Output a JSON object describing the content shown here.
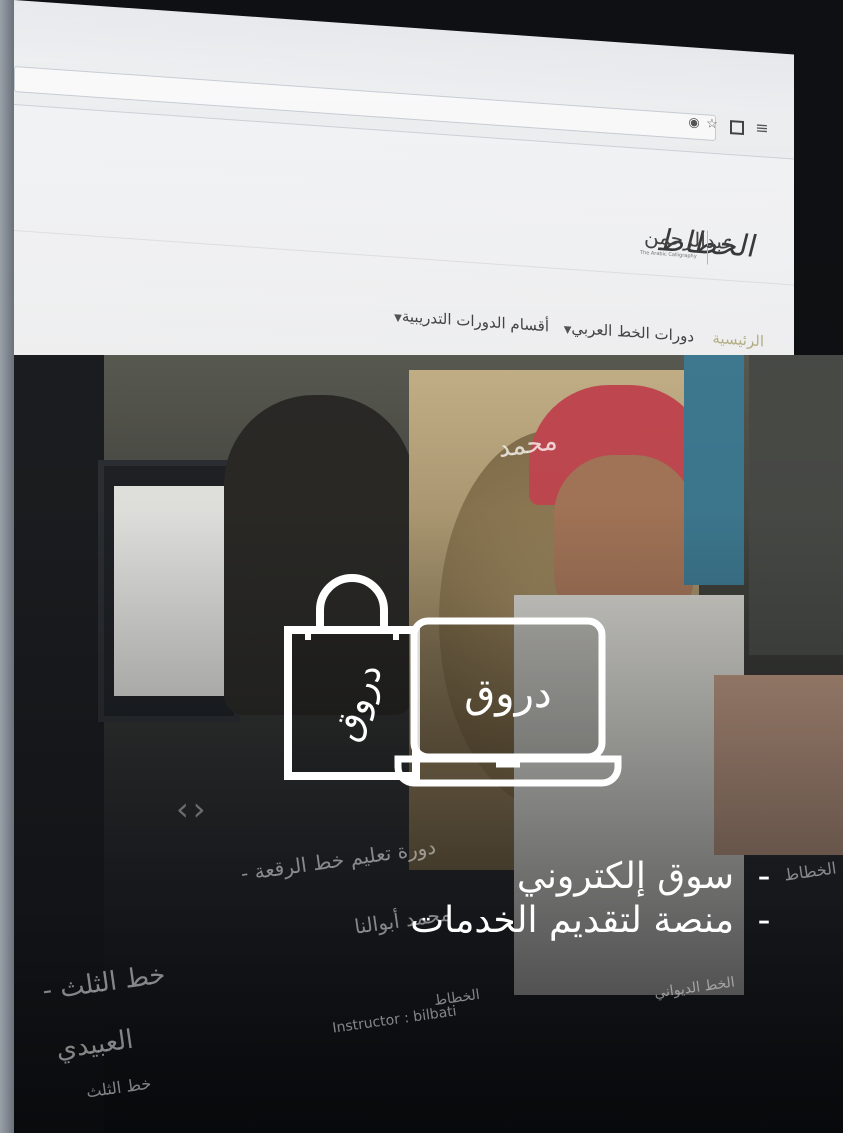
{
  "browser": {
    "menu_icon": "hamburger-icon"
  },
  "site": {
    "logo_text": "الخطاط",
    "sub_logo_text": "عبدالرحمن",
    "sub_logo_caption": "The Arabic Calligraphy"
  },
  "nav": {
    "items": [
      {
        "label": "الرئيسية",
        "active": true
      },
      {
        "label": "دورات الخط العربي",
        "active": false
      },
      {
        "label": "أقسام الدورات التدريبية",
        "active": false
      }
    ]
  },
  "background_text": {
    "course_title": "دورة تعليم خط الرقعة -",
    "instructor_name": "محمد أبوالنا",
    "left_title": "خط الثلث -",
    "left_sub": "العبيدي",
    "left_caption": "خط الثلث",
    "right_edge": "الخطاط",
    "instructor_label": "Instructor : bilbati",
    "category_label": "الخطاط",
    "diwani_label": "الخط الديواني",
    "calligraphy_frame": "محمد"
  },
  "icons": {
    "bag": "shopping-bag-icon",
    "laptop": "laptop-icon",
    "bag_calligraphy": "دروق",
    "laptop_calligraphy": "دروق"
  },
  "headline": {
    "bullets": [
      {
        "dash": "-",
        "text": "سوق إلكتروني"
      },
      {
        "dash": "-",
        "text": "منصة لتقديم الخدمات"
      }
    ]
  },
  "colors": {
    "nav_active": "#b9b58a",
    "overlay_text": "#ffffff",
    "icon_stroke": "#ffffff"
  }
}
